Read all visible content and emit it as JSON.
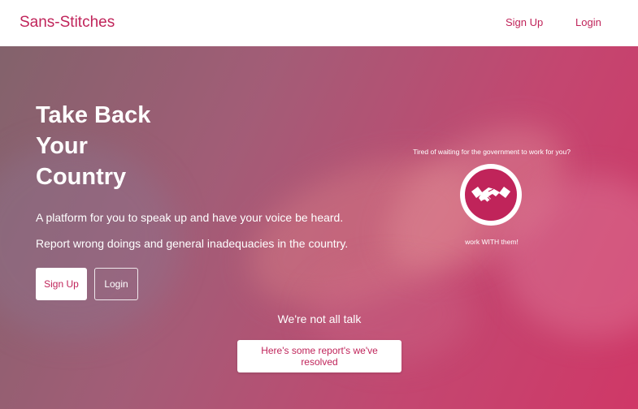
{
  "navbar": {
    "brand": "Sans-Stitches",
    "signup_label": "Sign Up",
    "login_label": "Login"
  },
  "hero": {
    "headline_lines": [
      "Take Back",
      "Your",
      "Country"
    ],
    "tagline_1": "A platform for you to speak up and have your voice be heard.",
    "tagline_2": "Report wrong doings and general inadequacies in the country.",
    "signup_label": "Sign Up",
    "login_label": "Login"
  },
  "promo": {
    "caption": "Tired of waiting for the government to work for you?",
    "icon": "handshake-icon",
    "subcaption": "work WITH them!"
  },
  "reports": {
    "heading": "We're not all talk",
    "button_label": "Here's some report's we've resolved"
  },
  "colors": {
    "accent": "#c0245a",
    "hero_overlay_start": "#78555f",
    "hero_overlay_end": "#cd2d5f"
  }
}
